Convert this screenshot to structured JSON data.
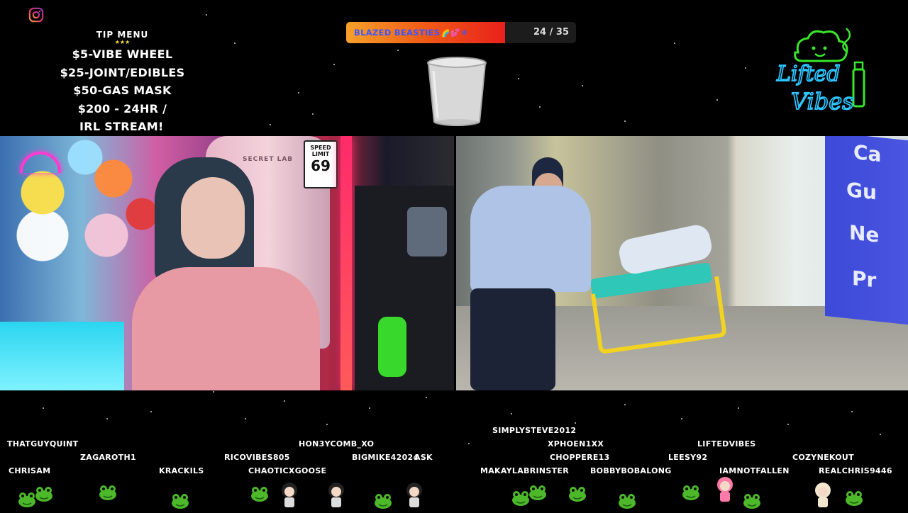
{
  "tip_menu": {
    "title": "TIP MENU",
    "stars": "★★★",
    "items": [
      "$5-VIBE WHEEL",
      "$25-JOINT/EDIBLES",
      "$50-GAS MASK",
      "$200 - 24HR /",
      "IRL STREAM!"
    ]
  },
  "goal": {
    "label": "BLAZED BEASTIES🌈💕❄",
    "count": "24 / 35",
    "progress": 0.69
  },
  "logo": {
    "line1": "Lifted",
    "line2": "Vibes"
  },
  "left_cam": {
    "sign_line1": "SPEED",
    "sign_line2": "LIMIT",
    "sign_value": "69",
    "chair_brand": "SECRET LAB"
  },
  "right_cam": {
    "sign_words": [
      "Ca",
      "Gu",
      "Ne",
      "Pr"
    ]
  },
  "chatters": [
    "THATGUYQUINT",
    "ZAGAROTH1",
    "CHRISAM",
    "KRACKILS",
    "RICOVIBES805",
    "CHAOTICXGOOSE",
    "HON3YCOMB_XO",
    "BIGMIKE42024",
    "ASK",
    "SIMPLYSTEVE2012",
    "XPHOEN1XX",
    "CHOPPERE13",
    "MAKAYLABRINSTER",
    "BOBBYBOBALONG",
    "LIFTEDVIBES",
    "LEESY92",
    "IAMNOTFALLEN",
    "COZYNEKOUT",
    "REALCHRIS9446"
  ],
  "colors": {
    "goal_fill_start": "#f7a12a",
    "goal_fill_end": "#e9201c",
    "goal_text": "#3b57ff",
    "logo_neon_green": "#39e62a",
    "logo_neon_blue": "#2ec5ff"
  },
  "icons": [
    "instagram-icon",
    "empty-cup-icon",
    "lifted-vibes-logo",
    "frog-avatar",
    "chibi-avatar"
  ]
}
